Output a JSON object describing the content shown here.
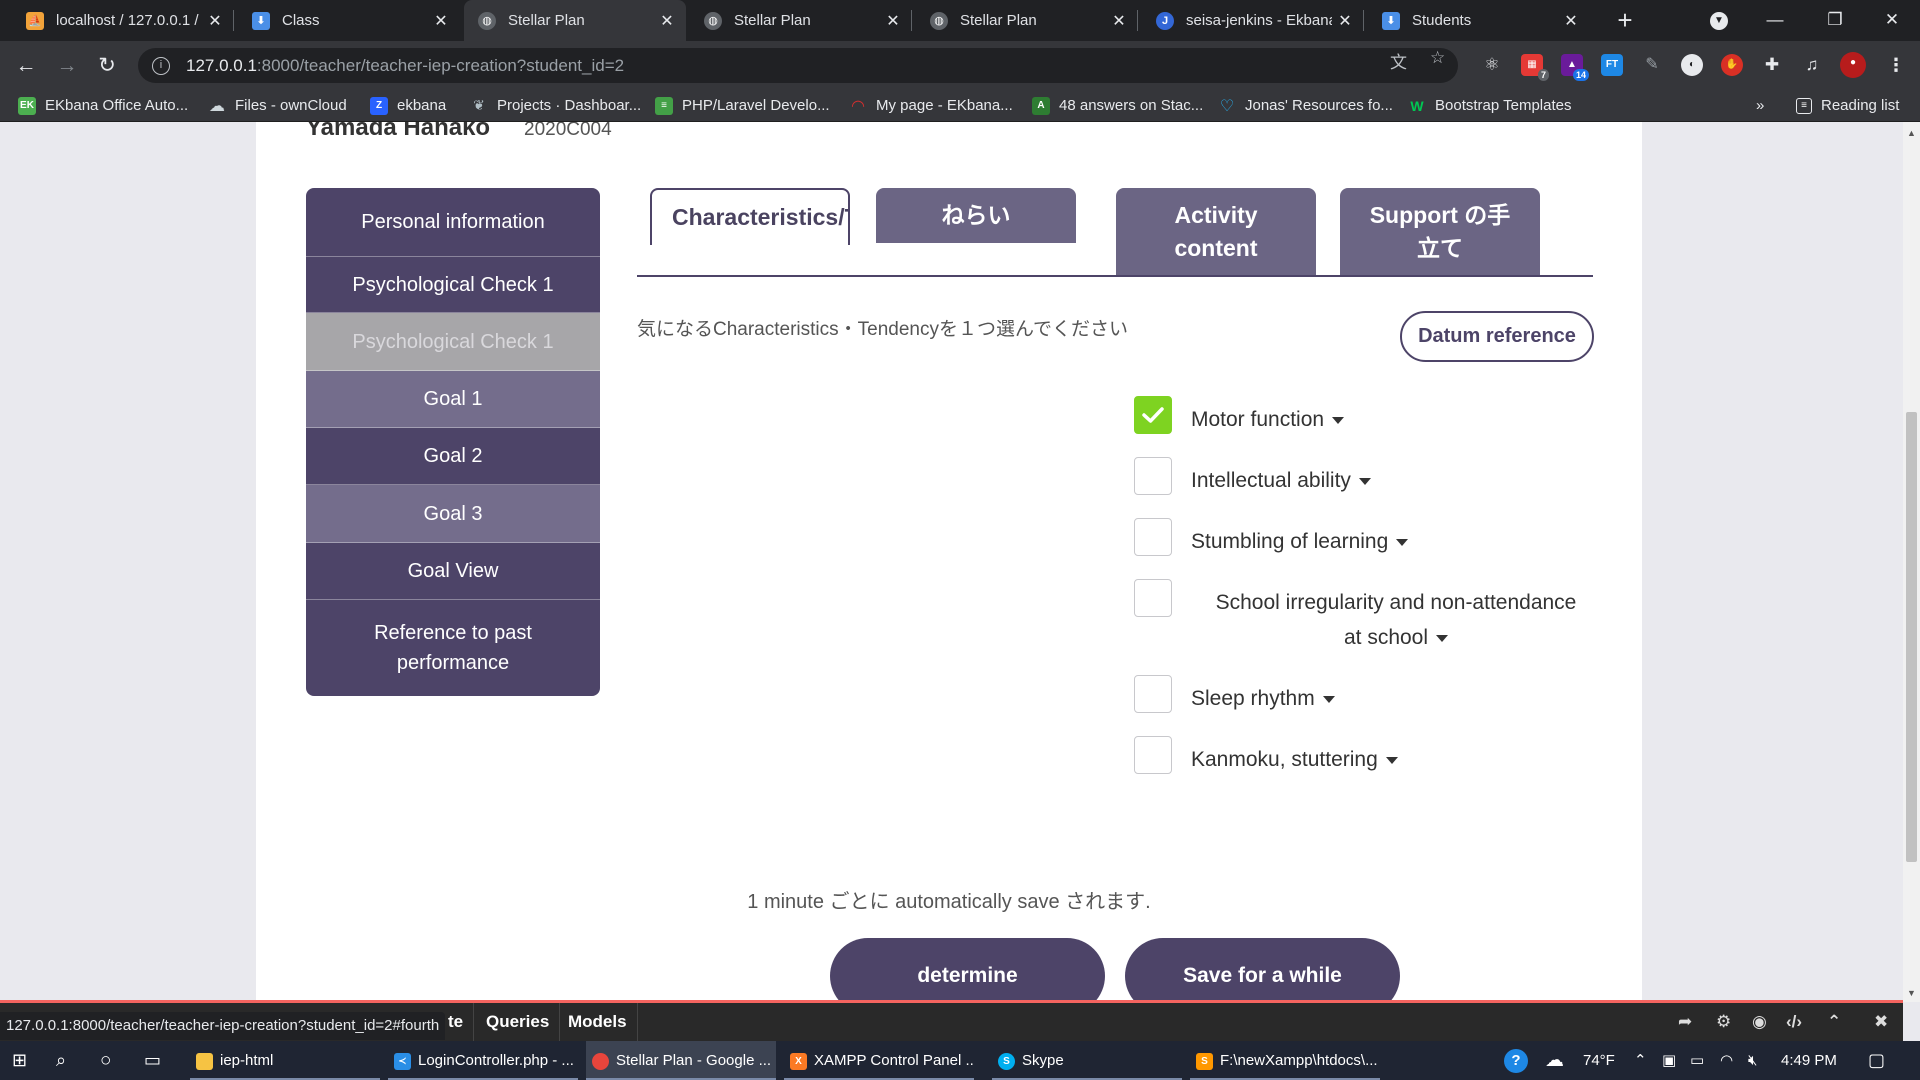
{
  "browser": {
    "tabs": [
      {
        "title": "localhost / 127.0.0.1 / ",
        "icon": "phpmyadmin-icon",
        "color": "#f2a33a"
      },
      {
        "title": "Class",
        "icon": "laravel-icon",
        "color": "#4a8fe7"
      },
      {
        "title": "Stellar Plan",
        "icon": "globe-icon",
        "color": "#9aa0a6",
        "active": true
      },
      {
        "title": "Stellar Plan",
        "icon": "globe-icon",
        "color": "#9aa0a6"
      },
      {
        "title": "Stellar Plan",
        "icon": "globe-icon",
        "color": "#9aa0a6"
      },
      {
        "title": "seisa-jenkins - Ekbana",
        "icon": "jenkins-icon",
        "color": "#3367d6"
      },
      {
        "title": "Students",
        "icon": "laravel-icon",
        "color": "#4a8fe7"
      }
    ],
    "url_host": "127.0.0.1",
    "url_path": ":8000/teacher/teacher-iep-creation?student_id=2",
    "bookmarks": [
      {
        "label": "EKbana Office Auto...",
        "icon": "ekbana-icon",
        "color": "#4caf50",
        "glyph": "EK"
      },
      {
        "label": "Files - ownCloud",
        "icon": "cloud-icon",
        "color": "#cfd8dc",
        "glyph": "☁"
      },
      {
        "label": "ekbana",
        "icon": "z-icon",
        "color": "#2962ff",
        "glyph": "Z"
      },
      {
        "label": "Projects · Dashboar...",
        "icon": "gitlab-icon",
        "color": "#b0bec5",
        "glyph": "❦"
      },
      {
        "label": "PHP/Laravel Develo...",
        "icon": "stack-icon",
        "color": "#43a047",
        "glyph": "≡"
      },
      {
        "label": "My page - EKbana...",
        "icon": "redmine-icon",
        "color": "#b71c1c",
        "glyph": "◠"
      },
      {
        "label": "48 answers on Stac...",
        "icon": "stackexchange-icon",
        "color": "#2e7d32",
        "glyph": "A"
      },
      {
        "label": "Jonas' Resources fo...",
        "icon": "heart-icon",
        "color": "#29b6f6",
        "glyph": "♡"
      },
      {
        "label": "Bootstrap Templates",
        "icon": "w-icon",
        "color": "#00c853",
        "glyph": "W"
      }
    ],
    "bookmarks_overflow": "»",
    "reading_list": "Reading list",
    "status_url": "127.0.0.1:8000/teacher/teacher-iep-creation?student_id=2#fourth"
  },
  "page": {
    "student_name": "Yamada Hanako",
    "student_id": "2020C004",
    "menu": [
      {
        "label": "Personal information",
        "state": "normal"
      },
      {
        "label": "Psychological Check 1",
        "state": "normal"
      },
      {
        "label": "Psychological Check 1",
        "state": "disabled"
      },
      {
        "label": "Goal 1",
        "state": "light"
      },
      {
        "label": "Goal 2",
        "state": "normal"
      },
      {
        "label": "Goal 3",
        "state": "light"
      },
      {
        "label": "Goal View",
        "state": "normal"
      },
      {
        "label": "Reference to past performance",
        "state": "normal"
      }
    ],
    "tabs": [
      {
        "label": "Characteristics/Tendency",
        "active": true
      },
      {
        "label": "ねらい"
      },
      {
        "label": "Activity content"
      },
      {
        "label": "Support の手立て"
      }
    ],
    "instruction": "気になるCharacteristics・Tendencyを１つ選んでください",
    "datum_reference": "Datum reference",
    "options": [
      {
        "label": "Motor function",
        "checked": true
      },
      {
        "label": "Intellectual ability",
        "checked": false
      },
      {
        "label": "Stumbling of learning",
        "checked": false
      },
      {
        "label": "School irregularity and non-attendance at school",
        "checked": false,
        "centered": true
      },
      {
        "label": "Sleep rhythm",
        "checked": false
      },
      {
        "label": "Kanmoku, stuttering",
        "checked": false
      }
    ],
    "autosave_note": "1 minute ごとに automatically save されます.",
    "determine_label": "determine",
    "save_label": "Save for a while"
  },
  "debugbar": {
    "tabs": [
      "te",
      "Queries",
      "Models"
    ]
  },
  "taskbar": {
    "apps": [
      {
        "label": "iep-html",
        "icon": "folder-icon",
        "color": "#f6c343"
      },
      {
        "label": "LoginController.php - ...",
        "icon": "vscode-icon",
        "color": "#2a8ee6"
      },
      {
        "label": "Stellar Plan - Google ...",
        "icon": "chrome-icon",
        "color": "#e8453c",
        "active": true
      },
      {
        "label": "XAMPP Control Panel ...",
        "icon": "xampp-icon",
        "color": "#fb7a24"
      },
      {
        "label": "Skype",
        "icon": "skype-icon",
        "color": "#00aff0"
      },
      {
        "label": "F:\\newXampp\\htdocs\\...",
        "icon": "sublime-icon",
        "color": "#ff9800"
      }
    ],
    "weather": "74°F",
    "time": "4:49 PM"
  },
  "colors": {
    "accent": "#4d4468",
    "accent_light": "#746d8c",
    "check_green": "#7ed321"
  }
}
